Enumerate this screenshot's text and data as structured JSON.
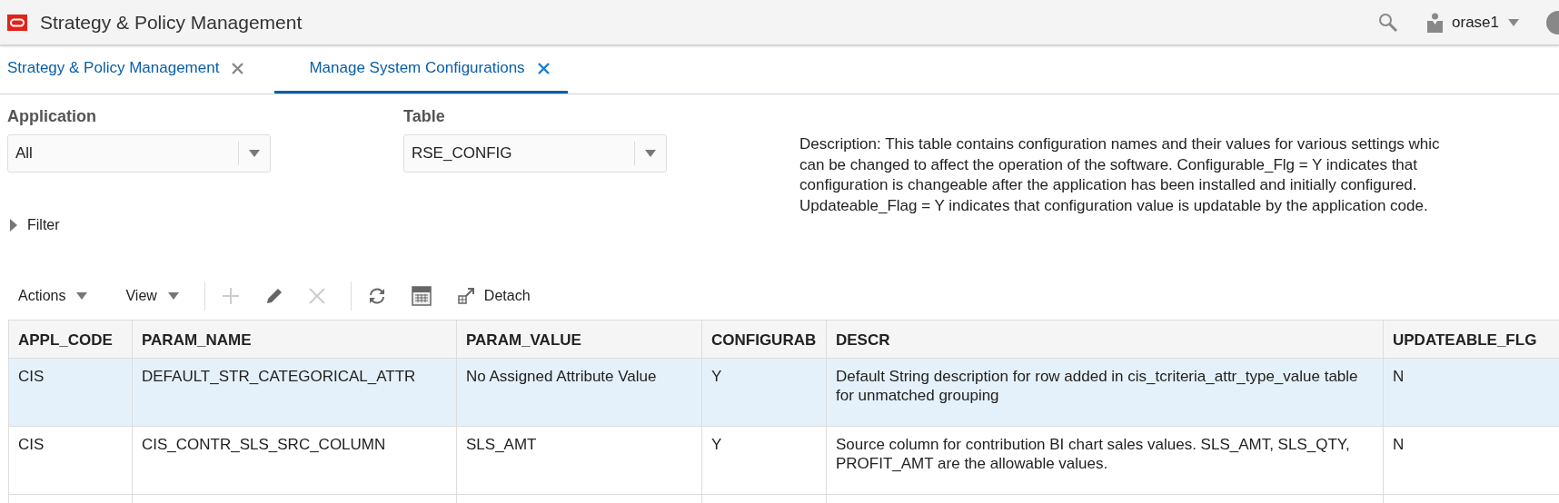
{
  "header": {
    "title": "Strategy & Policy Management",
    "user": "orase1"
  },
  "tabs": [
    {
      "label": "Strategy & Policy Management",
      "selected": false
    },
    {
      "label": "Manage System Configurations",
      "selected": true
    }
  ],
  "selectors": [
    {
      "label": "Application",
      "value": "All"
    },
    {
      "label": "Table",
      "value": "RSE_CONFIG"
    }
  ],
  "description_lines": [
    "Description: This table contains configuration names and their values for various settings whic",
    "can be changed to affect the operation of the software. Configurable_Flg = Y indicates that",
    "configuration is changeable after the application has been installed and initially configured.",
    "Updateable_Flag = Y indicates that configuration value is updatable by the application code."
  ],
  "filter": {
    "label": "Filter",
    "expanded": false
  },
  "toolbar": {
    "menus": [
      "Actions",
      "View"
    ],
    "icons": [
      {
        "kind": "add",
        "disabled": true
      },
      {
        "kind": "edit",
        "disabled": false
      },
      {
        "kind": "delete",
        "disabled": true
      },
      {
        "kind": "refresh",
        "disabled": false
      },
      {
        "kind": "export",
        "disabled": false
      }
    ],
    "detach": "Detach"
  },
  "table": {
    "columns": [
      "APPL_CODE",
      "PARAM_NAME",
      "PARAM_VALUE",
      "CONFIGURAB",
      "DESCR",
      "UPDATEABLE_FLG"
    ],
    "rows": [
      {
        "selected": true,
        "cells": [
          "CIS",
          "DEFAULT_STR_CATEGORICAL_ATTR",
          "No Assigned Attribute Value",
          "Y",
          "Default String description for row added in cis_tcriteria_attr_type_value table for unmatched grouping",
          "N"
        ]
      },
      {
        "selected": false,
        "cells": [
          "CIS",
          "CIS_CONTR_SLS_SRC_COLUMN",
          "SLS_AMT",
          "Y",
          "Source column for contribution BI chart sales values. SLS_AMT, SLS_QTY, PROFIT_AMT are the allowable values.",
          "N"
        ]
      }
    ]
  }
}
